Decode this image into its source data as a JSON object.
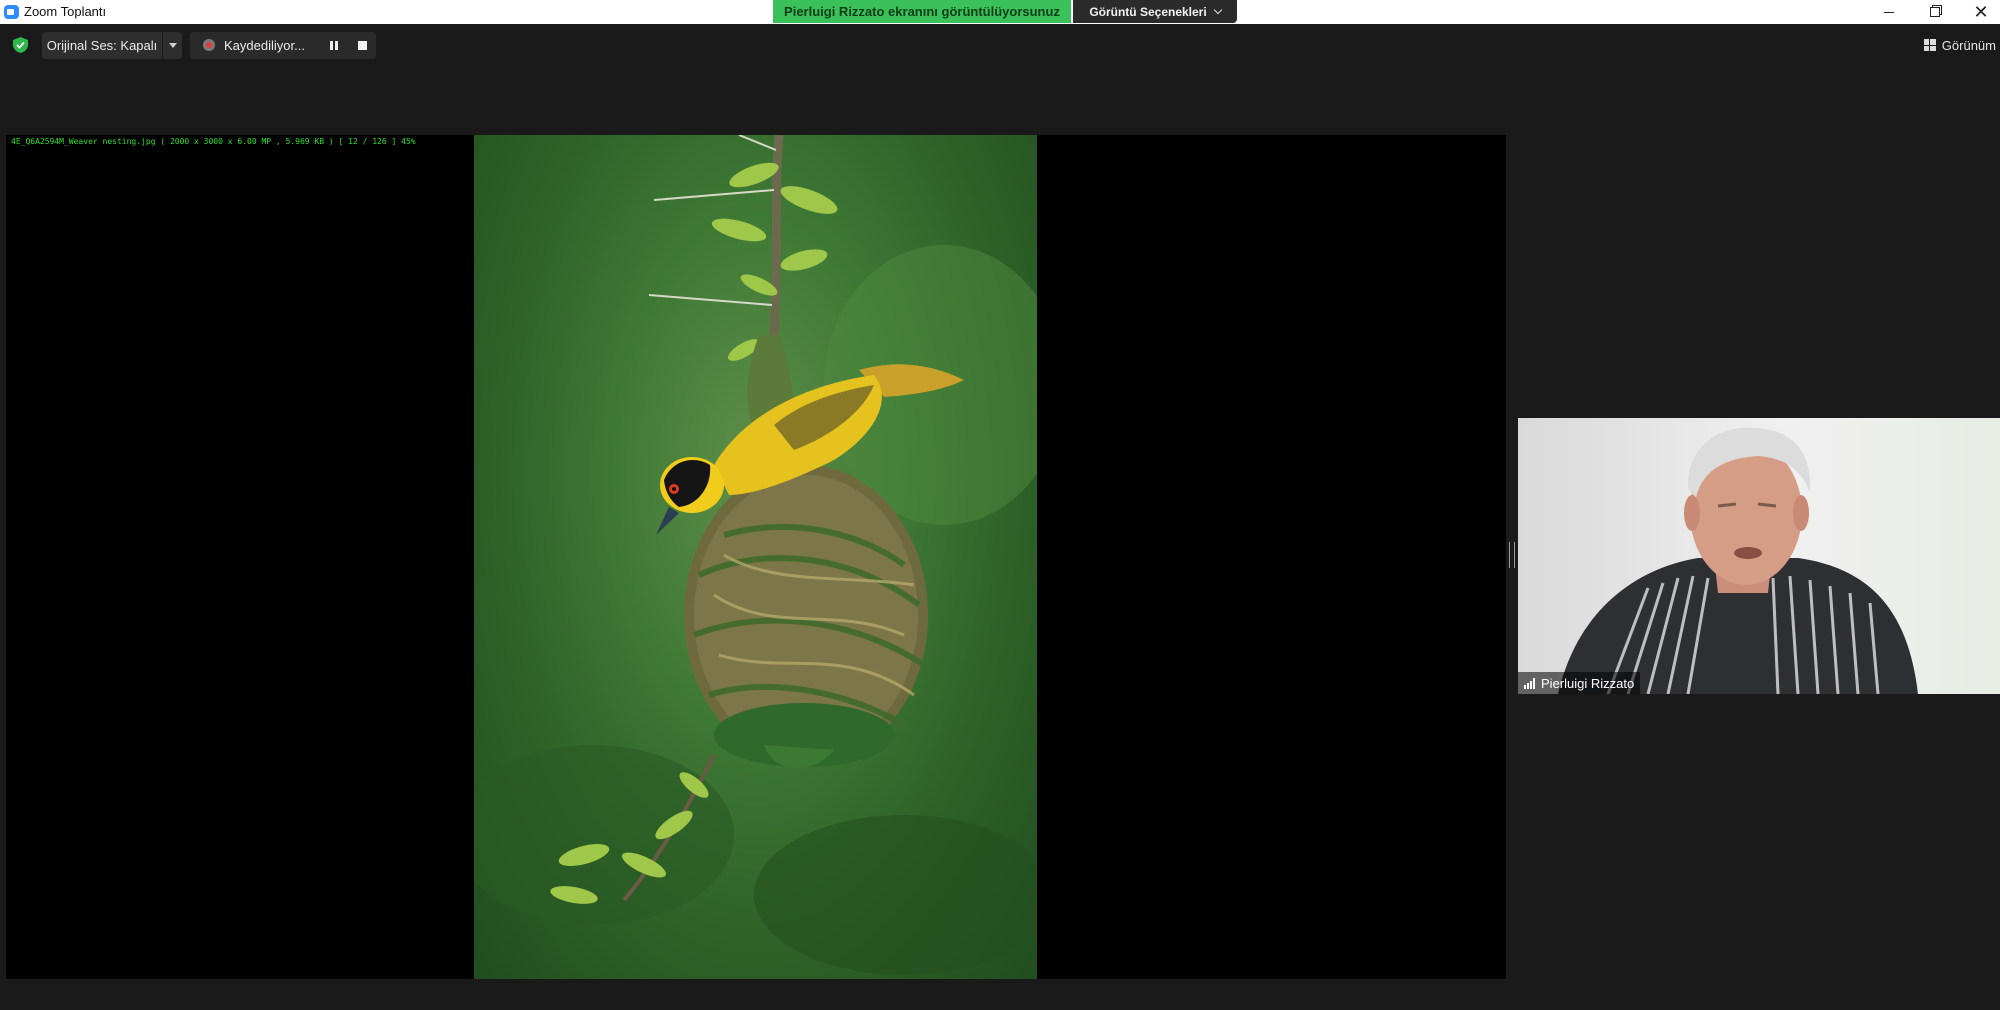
{
  "window": {
    "title": "Zoom Toplantı"
  },
  "share": {
    "banner": "Pierluigi Rizzato ekranını görüntülüyorsunuz",
    "view_options": "Görüntü Seçenekleri"
  },
  "toolbar": {
    "original_audio": "Orijinal Ses: Kapalı",
    "recording": "Kaydediliyor...",
    "view": "Görünüm"
  },
  "screen": {
    "file_info": "4E_Q6A2594M_Weaver nesting.jpg  ( 2000 x 3000 x 6.00 MP  ,  5.969 KB )  [ 12 / 126 ]   45%"
  },
  "participant": {
    "name": "Pierluigi Rizzato"
  },
  "colors": {
    "share_banner": "#3bc159",
    "background": "#1a1a1a",
    "zoom_blue": "#2d8cff"
  }
}
